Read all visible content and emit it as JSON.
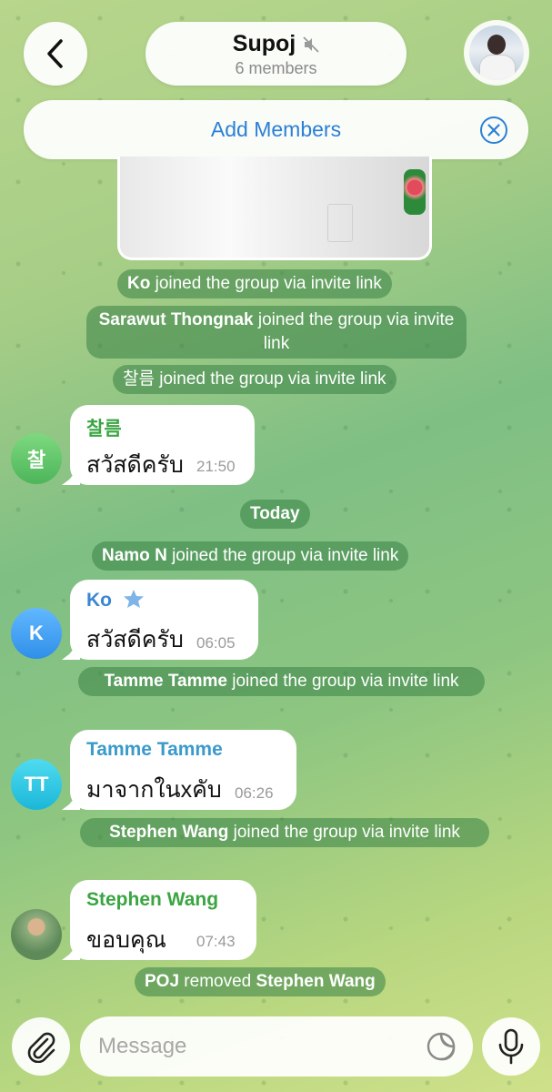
{
  "header": {
    "title": "Supoj",
    "subtitle": "6 members",
    "add_members_label": "Add Members"
  },
  "events": {
    "ko_joined": {
      "name": "Ko",
      "text": " joined the group via invite link"
    },
    "sarawut_joined": {
      "name": "Sarawut Thongnak",
      "text": " joined the group via invite link"
    },
    "chalreum_joined": {
      "name": "찰름",
      "text": " joined the group via invite link"
    },
    "date_today": "Today",
    "namo_joined": {
      "name": "Namo N",
      "text": " joined the group via invite link"
    },
    "tamme_joined": {
      "name": "Tamme Tamme",
      "text": " joined the group via invite link"
    },
    "stephen_joined": {
      "name": "Stephen Wang",
      "text": " joined the group via invite link"
    },
    "removed": {
      "actor": "POJ",
      "text": " removed ",
      "target": "Stephen Wang"
    }
  },
  "messages": [
    {
      "avatar_initials": "찰",
      "sender": "찰름",
      "text": "สวัสดีครับ",
      "time": "21:50",
      "sender_color": "#3aa542",
      "avatar_color": "#5cc56b"
    },
    {
      "avatar_initials": "K",
      "sender": "Ko",
      "text": "สวัสดีครับ",
      "time": "06:05",
      "sender_color": "#3a86d2",
      "avatar_color": "#3f9ef0"
    },
    {
      "avatar_initials": "TT",
      "sender": "Tamme Tamme",
      "text": "มาจากในxคับ",
      "time": "06:26",
      "sender_color": "#3a9acb",
      "avatar_color": "#33c7e6"
    },
    {
      "avatar_initials": "",
      "sender": "Stephen Wang",
      "text": "ขอบคุณ",
      "time": "07:43",
      "sender_color": "#3aa542",
      "avatar_color": "#7a9a6a"
    }
  ],
  "composer": {
    "placeholder": "Message"
  },
  "icons": {
    "back": "chevron-left-icon",
    "muted": "muted-speaker-icon",
    "close": "close-circle-icon",
    "star": "star-icon",
    "attach": "paperclip-icon",
    "sticker": "sticker-icon",
    "mic": "microphone-icon"
  },
  "colors": {
    "accent": "#2b7fd6",
    "service_pill": "#388246"
  }
}
